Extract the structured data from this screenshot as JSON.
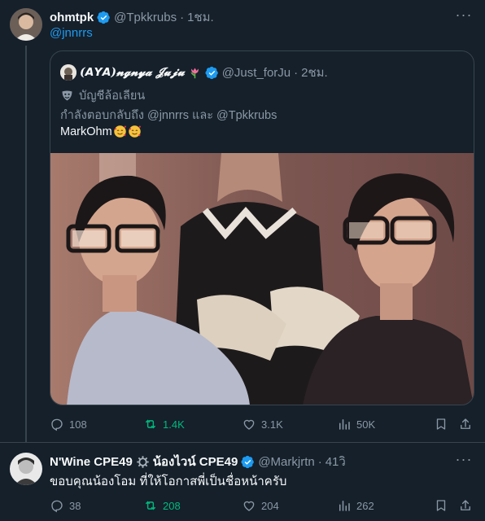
{
  "tweet1": {
    "display_name": "ohmtpk",
    "handle": "@Tpkkrubs",
    "time": "1ชม.",
    "separator": "·",
    "reply_text": "@jnnrrs",
    "quote": {
      "display_name": "(𝘼𝙔𝘼)𝓷𝓰𝓷𝔂𝓪 𝓙𝓾𝓳𝓾",
      "handle": "@Just_forJu",
      "time": "2ชม.",
      "separator": "·",
      "label": "บัญชีล้อเลียน",
      "replying_to": "กำลังตอบกลับถึง @jnnrrs และ @Tpkkrubs",
      "text": "MarkOhm"
    },
    "stats": {
      "replies": "108",
      "retweets": "1.4K",
      "likes": "3.1K",
      "views": "50K"
    }
  },
  "tweet2": {
    "display_name": "N'Wine CPE49",
    "display_name_suffix": "น้องไวน์ CPE49",
    "handle": "@Markjrtn",
    "time": "41วิ",
    "separator": "·",
    "text": "ขอบคุณน้องโอม ที่ให้โอกาสพี่เป็นชื่อหน้าครับ",
    "stats": {
      "replies": "38",
      "retweets": "208",
      "likes": "204",
      "views": "262"
    }
  },
  "colors": {
    "background": "#15202b",
    "accent": "#1d9bf0",
    "retweet_active": "#00ba7c",
    "muted": "#8b98a5",
    "border": "#38444d"
  },
  "icons": [
    "verified-badge",
    "gear-icon",
    "tulip-emoji",
    "smiling-hearts-emoji",
    "theater-mask-emoji",
    "reply-icon",
    "retweet-icon",
    "like-icon",
    "views-icon",
    "bookmark-icon",
    "share-icon",
    "more-icon"
  ]
}
